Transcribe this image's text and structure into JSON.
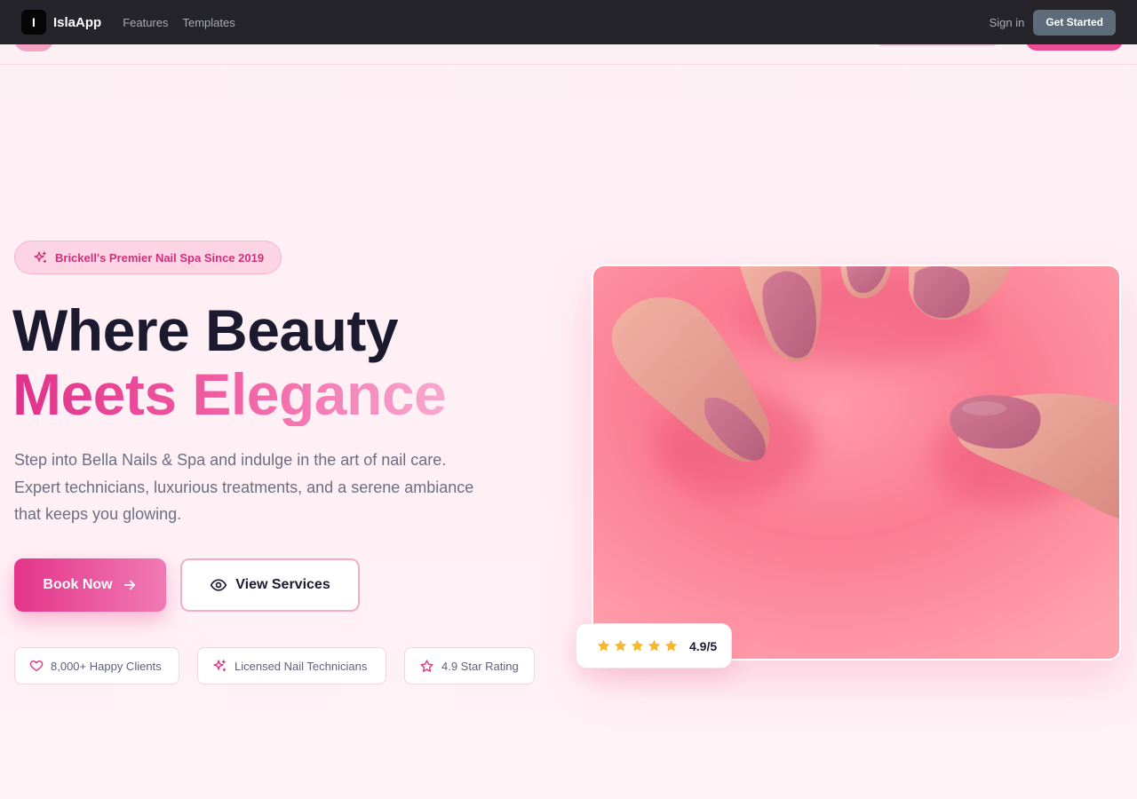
{
  "app": {
    "logo_letter": "I",
    "name": "IslaApp",
    "nav": [
      "Features",
      "Templates"
    ],
    "sign_in": "Sign in",
    "get_started": "Get Started"
  },
  "hero": {
    "badge": "Brickell's Premier Nail Spa Since 2019",
    "title_line1": "Where Beauty",
    "title_line2": "Meets Elegance",
    "description": "Step into Bella Nails & Spa and indulge in the art of nail care. Expert technicians, luxurious treatments, and a serene ambiance that keeps you glowing.",
    "book_now": "Book Now",
    "view_services": "View Services",
    "features": [
      {
        "icon": "heart-icon",
        "label": "8,000+ Happy Clients"
      },
      {
        "icon": "sparkles-icon",
        "label": "Licensed Nail Technicians"
      },
      {
        "icon": "star-outline-icon",
        "label": "4.9 Star Rating"
      }
    ],
    "rating": {
      "stars": 5,
      "value": "4.9/5"
    }
  },
  "colors": {
    "accent": "#e4348a",
    "accent_light": "#fdd4e3",
    "topbar": "#25242b",
    "star": "#f5b82e"
  }
}
